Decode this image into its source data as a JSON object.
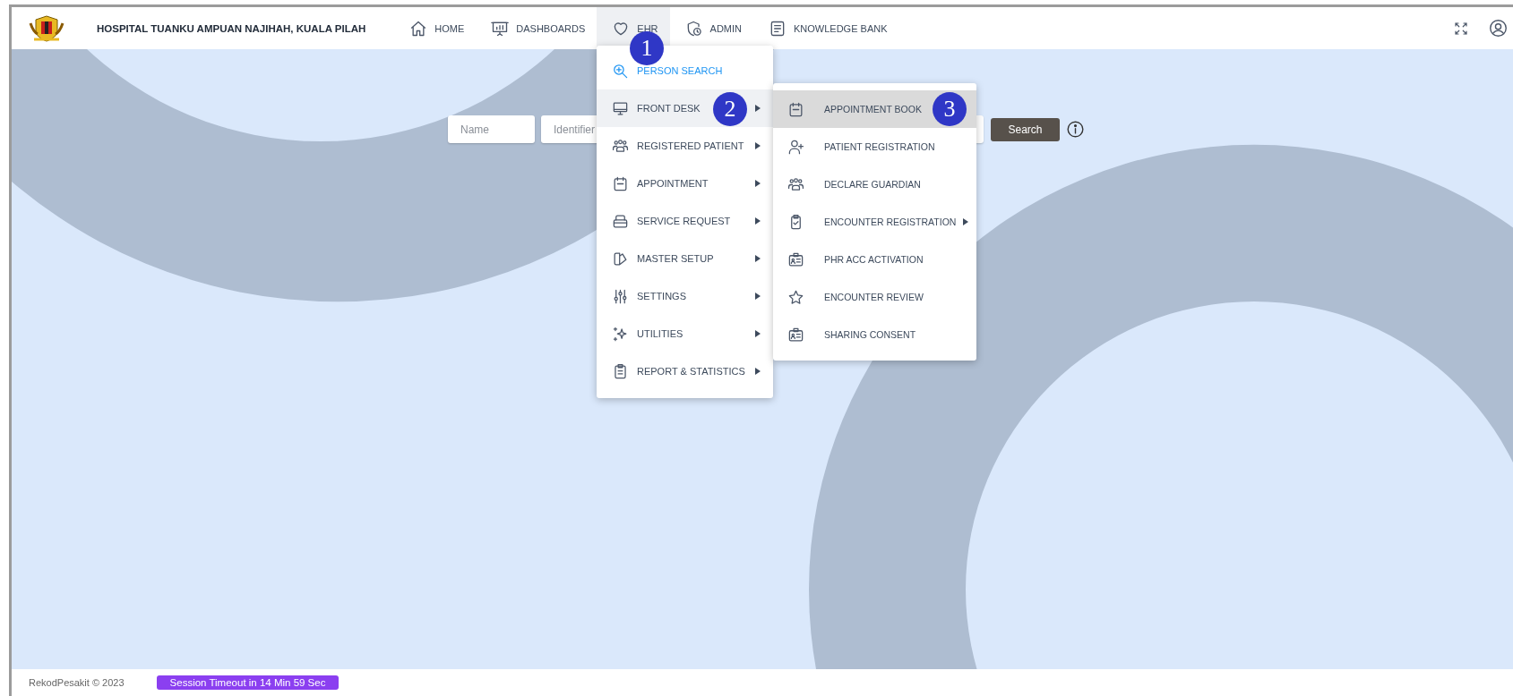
{
  "header": {
    "title": "HOSPITAL TUANKU AMPUAN NAJIHAH, KUALA PILAH"
  },
  "nav": [
    {
      "label": "HOME",
      "kind": "home",
      "selected": false
    },
    {
      "label": "DASHBOARDS",
      "kind": "dashboard",
      "selected": false
    },
    {
      "label": "EHR",
      "kind": "heart",
      "selected": true
    },
    {
      "label": "ADMIN",
      "kind": "admin",
      "selected": false
    },
    {
      "label": "KNOWLEDGE BANK",
      "kind": "document",
      "selected": false
    }
  ],
  "search": {
    "fields": [
      {
        "placeholder": "Name"
      },
      {
        "placeholder": "Identifier"
      }
    ],
    "button": "Search"
  },
  "menu": {
    "items": [
      {
        "label": "PERSON SEARCH",
        "kind": "search",
        "active": true,
        "selected": false,
        "submenu": false
      },
      {
        "label": "FRONT DESK",
        "kind": "monitor",
        "active": false,
        "selected": true,
        "submenu": true
      },
      {
        "label": "REGISTERED PATIENT",
        "kind": "people",
        "active": false,
        "selected": false,
        "submenu": true
      },
      {
        "label": "APPOINTMENT",
        "kind": "calendar",
        "active": false,
        "selected": false,
        "submenu": true
      },
      {
        "label": "SERVICE REQUEST",
        "kind": "tray",
        "active": false,
        "selected": false,
        "submenu": true
      },
      {
        "label": "MASTER SETUP",
        "kind": "setup",
        "active": false,
        "selected": false,
        "submenu": true
      },
      {
        "label": "SETTINGS",
        "kind": "sliders",
        "active": false,
        "selected": false,
        "submenu": true
      },
      {
        "label": "UTILITIES",
        "kind": "sparkle",
        "active": false,
        "selected": false,
        "submenu": true
      },
      {
        "label": "REPORT & STATISTICS",
        "kind": "clipboard",
        "active": false,
        "selected": false,
        "submenu": true
      }
    ]
  },
  "submenu": {
    "items": [
      {
        "label": "APPOINTMENT BOOK",
        "kind": "calendar",
        "selected": true,
        "submenu": false
      },
      {
        "label": "PATIENT REGISTRATION",
        "kind": "person-add",
        "selected": false,
        "submenu": false
      },
      {
        "label": "DECLARE GUARDIAN",
        "kind": "people",
        "selected": false,
        "submenu": false
      },
      {
        "label": "ENCOUNTER REGISTRATION",
        "kind": "clipboard-check",
        "selected": false,
        "submenu": true
      },
      {
        "label": "PHR ACC ACTIVATION",
        "kind": "id-card",
        "selected": false,
        "submenu": false
      },
      {
        "label": "ENCOUNTER REVIEW",
        "kind": "star",
        "selected": false,
        "submenu": false
      },
      {
        "label": "SHARING CONSENT",
        "kind": "id-card",
        "selected": false,
        "submenu": false
      }
    ]
  },
  "annotations": [
    {
      "number": "1"
    },
    {
      "number": "2"
    },
    {
      "number": "3"
    }
  ],
  "footer": {
    "copyright": "RekodPesakit © 2023",
    "session": "Session Timeout in 14 Min 59 Sec"
  }
}
